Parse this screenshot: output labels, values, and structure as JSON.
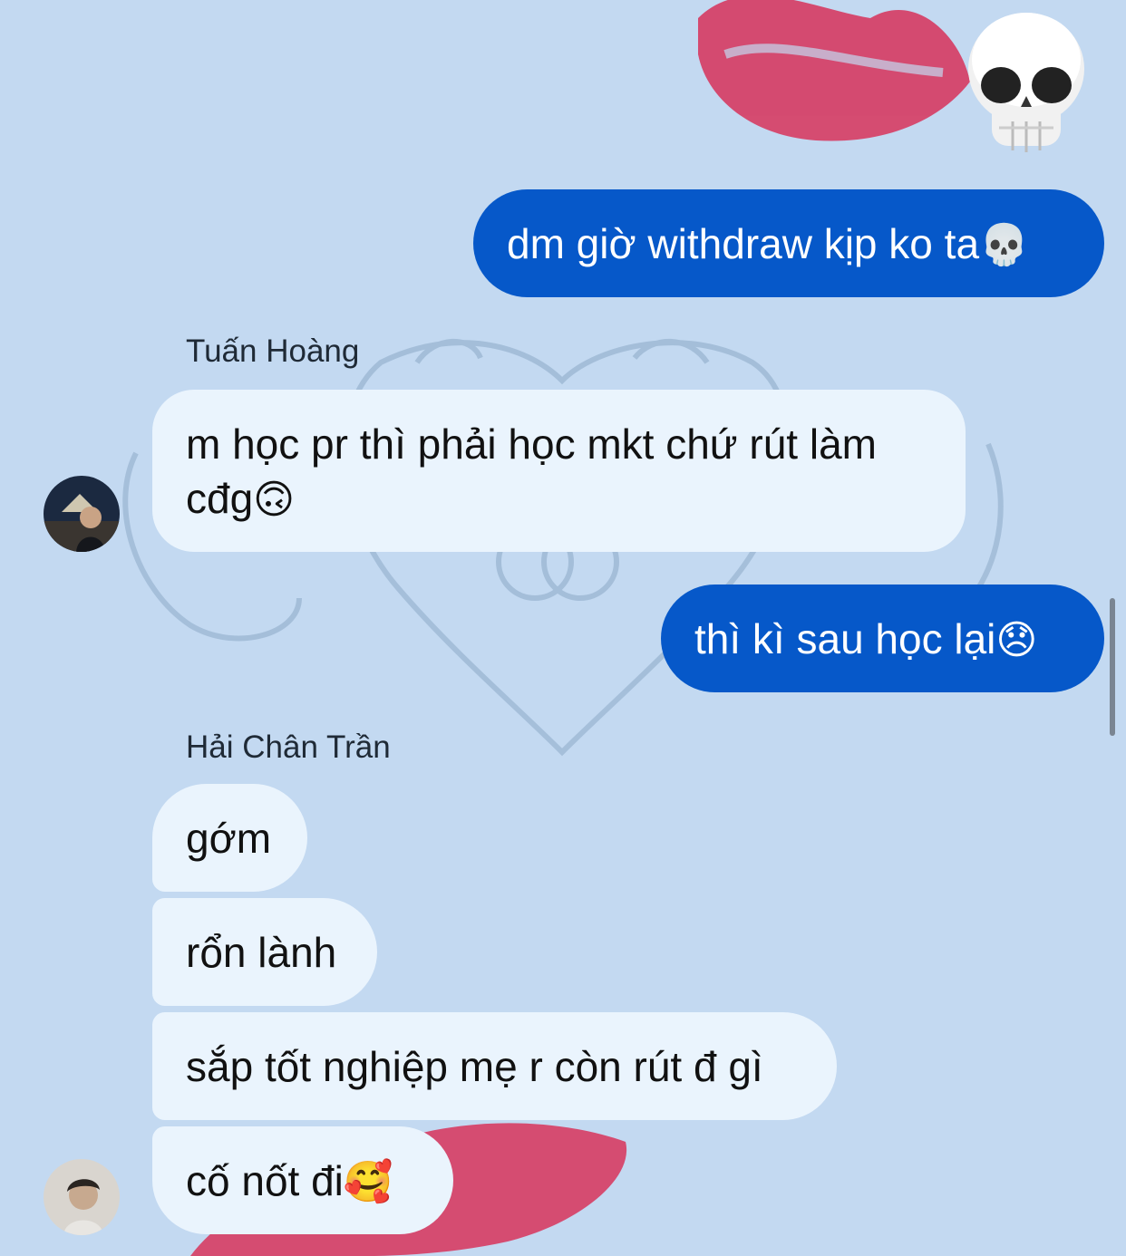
{
  "messages": [
    {
      "type": "emoji",
      "direction": "outgoing",
      "icon": "skull-icon"
    },
    {
      "type": "text",
      "direction": "outgoing",
      "text": "dm giờ withdraw kịp ko ta",
      "emoji": "💀"
    },
    {
      "type": "text",
      "direction": "incoming",
      "sender": "Tuấn Hoàng",
      "text": "m học pr thì phải học mkt chứ rút làm cđg",
      "emoji": "🙃"
    },
    {
      "type": "text",
      "direction": "outgoing",
      "text": "thì kì sau học lại",
      "emoji": "😞"
    },
    {
      "type": "text",
      "direction": "incoming",
      "sender": "Hải Chân Trần",
      "text": "gớm"
    },
    {
      "type": "text",
      "direction": "incoming",
      "text": "rổn lành"
    },
    {
      "type": "text",
      "direction": "incoming",
      "text": "sắp tốt nghiệp mẹ r còn rút đ gì"
    },
    {
      "type": "text",
      "direction": "incoming",
      "text": "cố nốt đi",
      "emoji": "🥰"
    }
  ],
  "theme": {
    "background": "#c3d9f1",
    "outgoing_bubble": "#0658c9",
    "incoming_bubble": "#eaf4fd",
    "lips_accent": "#d8325a"
  }
}
